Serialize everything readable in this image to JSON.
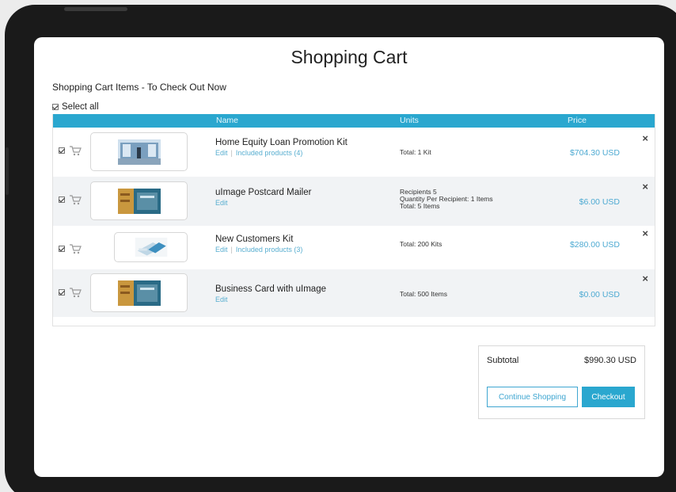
{
  "page": {
    "title": "Shopping Cart"
  },
  "cart": {
    "section_title": "Shopping Cart Items - To Check Out Now",
    "select_all_label": "Select all",
    "columns": {
      "name": "Name",
      "units": "Units",
      "price": "Price"
    },
    "items": [
      {
        "name": "Home Equity Loan Promotion Kit",
        "edit": "Edit",
        "included": "Included products (4)",
        "units": [
          "Total: 1 Kit"
        ],
        "price": "$704.30 USD",
        "thumb_icon": "promotion-kit-thumbnail"
      },
      {
        "name": "uImage Postcard Mailer",
        "edit": "Edit",
        "included": "",
        "units": [
          "Recipients 5",
          "Quantity Per Recipient: 1 Items",
          "Total: 5 Items"
        ],
        "price": "$6.00 USD",
        "thumb_icon": "postcard-thumbnail"
      },
      {
        "name": "New Customers Kit",
        "edit": "Edit",
        "included": "Included products (3)",
        "units": [
          "Total: 200 Kits"
        ],
        "price": "$280.00 USD",
        "thumb_icon": "customers-kit-thumbnail"
      },
      {
        "name": "Business Card with uImage",
        "edit": "Edit",
        "included": "",
        "units": [
          "Total: 500 Items"
        ],
        "price": "$0.00 USD",
        "thumb_icon": "business-card-thumbnail"
      }
    ],
    "close_symbol": "×"
  },
  "summary": {
    "subtotal_label": "Subtotal",
    "subtotal_value": "$990.30 USD",
    "continue_label": "Continue Shopping",
    "checkout_label": "Checkout"
  },
  "colors": {
    "accent": "#2aa7cf",
    "link": "#58aed0",
    "price": "#4eaad2",
    "device_frame": "#1a1a1a"
  }
}
